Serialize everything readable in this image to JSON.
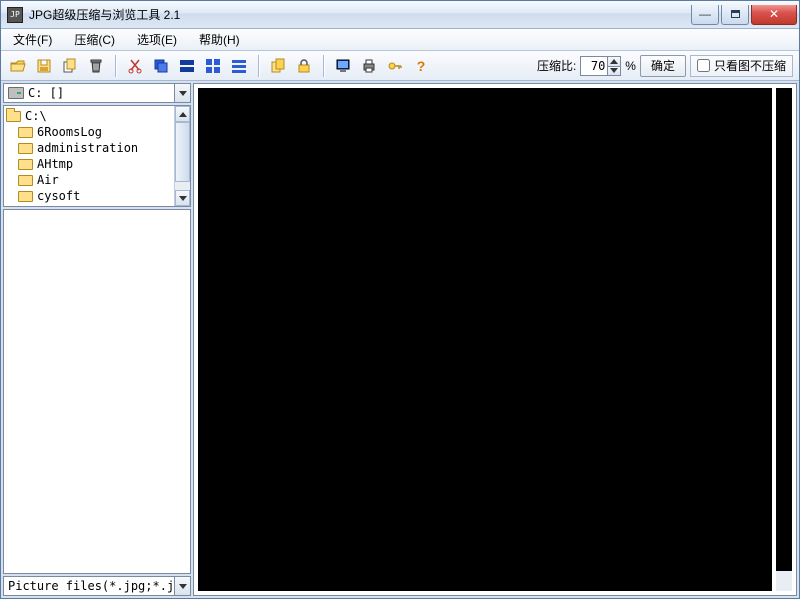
{
  "window": {
    "title": "JPG超级压缩与浏览工具 2.1"
  },
  "menu": {
    "file": "文件(F)",
    "compress": "压缩(C)",
    "options": "选项(E)",
    "help": "帮助(H)"
  },
  "toolbar": {
    "icons": [
      "open-folder-icon",
      "save-icon",
      "copy-icon",
      "delete-icon",
      "cut-icon",
      "stack-icon",
      "tile-dark-icon",
      "grid-icon",
      "list-icon",
      "duplicate-icon",
      "lock-icon",
      "monitor-icon",
      "printer-icon",
      "key-icon",
      "help-icon"
    ],
    "ratio_label": "压缩比:",
    "ratio_value": "70",
    "ratio_suffix": "%",
    "confirm": "确定",
    "view_only_label": "只看图不压缩",
    "view_only_checked": false
  },
  "drive": {
    "label": "C: []"
  },
  "tree": {
    "root": "C:\\",
    "items": [
      "6RoomsLog",
      "administration",
      "AHtmp",
      "Air",
      "cysoft"
    ]
  },
  "filter": {
    "text": "Picture files(*.jpg;*.jpe"
  }
}
